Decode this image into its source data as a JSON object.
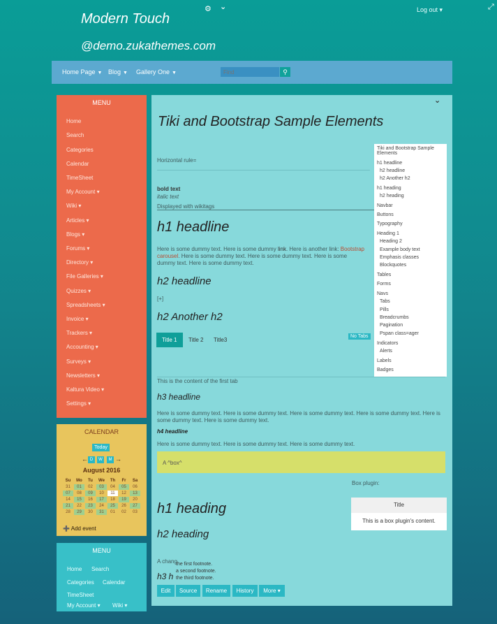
{
  "top": {
    "settings_icon": "⚙",
    "chevron_icon": "⌄",
    "logout": "Log out ▾",
    "expand_icon": "⤢"
  },
  "site": {
    "title": "Modern Touch",
    "subtitle": "@demo.zukathemes.com"
  },
  "nav": {
    "items": [
      "Home Page",
      "Blog",
      "Gallery One"
    ],
    "search_placeholder": "Find",
    "search_icon": "🔍"
  },
  "menu": {
    "title": "MENU",
    "items": [
      "Home",
      "Search",
      "Categories",
      "Calendar",
      "TimeSheet",
      "My Account ▾",
      "Wiki ▾",
      "Articles ▾",
      "Blogs ▾",
      "Forums ▾",
      "Directory ▾",
      "File Galleries ▾",
      "Quizzes ▾",
      "Spreadsheets ▾",
      "Invoice ▾",
      "Trackers ▾",
      "Accounting ▾",
      "Surveys ▾",
      "Newsletters ▾",
      "Kaltura Video ▾",
      "Settings ▾"
    ]
  },
  "calendar": {
    "title": "CALENDAR",
    "today": "Today",
    "prev": "←",
    "next": "→",
    "views": [
      "D",
      "W",
      "M"
    ],
    "month": "August 2016",
    "days": [
      "Su",
      "Mo",
      "Tu",
      "We",
      "Th",
      "Fr",
      "Sa"
    ],
    "weeks": [
      [
        "31",
        "01",
        "02",
        "03",
        "04",
        "05",
        "06"
      ],
      [
        "07",
        "08",
        "09",
        "10",
        "11",
        "12",
        "13"
      ],
      [
        "14",
        "15",
        "16",
        "17",
        "18",
        "19",
        "20"
      ],
      [
        "21",
        "22",
        "23",
        "24",
        "25",
        "26",
        "27"
      ],
      [
        "28",
        "29",
        "30",
        "31",
        "01",
        "02",
        "03"
      ]
    ],
    "add_event": "Add event"
  },
  "menu2": {
    "title": "MENU",
    "items": [
      "Home",
      "Search",
      "Categories",
      "Calendar",
      "TimeSheet",
      "My Account ▾",
      "Wiki ▾"
    ]
  },
  "main": {
    "title": "Tiki and Bootstrap Sample Elements",
    "horizontal_rule": "Horizontal rule=",
    "bold": "bold text",
    "italic": "italic text",
    "wikitags": "Displayed with wikitags",
    "h1": "h1 headline",
    "para1a": "Here is some dummy text. Here is some dummy ",
    "para1_link": "link",
    "para1b": ". Here is another link: ",
    "para1_link2": "Bootstrap carousel",
    "para1c": ". Here is some dummy text. Here is some dummy text. Here is some dummy text. Here is some dummy text.",
    "h2": "h2 headline",
    "expand": "[+]",
    "h2b": "h2 Another h2",
    "tabs": [
      "Title 1",
      "Title 2",
      "Title3"
    ],
    "no_tabs": "No Tabs",
    "tab_content": "This is the content of the first tab",
    "h3": "h3 headline",
    "para2": "Here is some dummy text. Here is some dummy text. Here is some dummy text. Here is some dummy text. Here is some dummy text. Here is some dummy text.",
    "h4": "h4 headline",
    "para3": "Here is some dummy text. Here is some dummy text. Here is some dummy text.",
    "box": "A ^box^",
    "plugin_label": "Box plugin:",
    "plugin_title": "Title",
    "plugin_body": "This is a box plugin's content.",
    "h1_heading": "h1 heading",
    "h2_heading": "h2 heading",
    "footnote_prefix": "A chang",
    "footnotes": [
      "the first footnote.",
      "a second footnote.",
      "the third footnote."
    ],
    "h3_prefix": "h3 h",
    "actions": [
      "Edit",
      "Source",
      "Rename",
      "History",
      "More ▾"
    ]
  },
  "toc": {
    "items": [
      "Tiki and Bootstrap Sample",
      "Elements",
      "h1 headline",
      "h2 headline",
      "h2 Another h2",
      "h1 heading",
      "h2 heading",
      "Navbar",
      "Buttons",
      "Typography",
      "Heading 1",
      "Heading 2",
      "Example body text",
      "Emphasis classes",
      "Blockquotes",
      "Tables",
      "Forms",
      "Navs",
      "Tabs",
      "Pills",
      "Breadcrumbs",
      "Pagination",
      "Pspan class=ager",
      "Indicators",
      "Alerts",
      "Labels",
      "Badges"
    ]
  }
}
